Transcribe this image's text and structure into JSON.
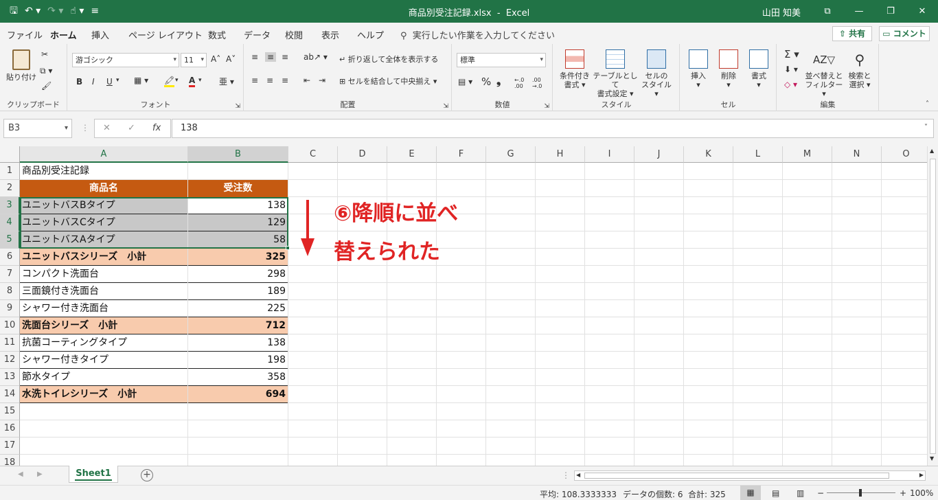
{
  "titlebar": {
    "filename": "商品別受注記録.xlsx",
    "separator": "-",
    "app": "Excel",
    "user": "山田 知美",
    "qat_save": "🖫",
    "qat_undo": "↶ ▾",
    "qat_redo": "↷ ▾",
    "qat_touch": "☝ ▾",
    "qat_custom": "≡",
    "ribbon_display": "⧉",
    "minimize": "—",
    "restore": "❐",
    "close": "✕"
  },
  "menu": {
    "tabs": [
      "ファイル",
      "ホーム",
      "挿入",
      "ページ レイアウト",
      "数式",
      "データ",
      "校閲",
      "表示",
      "ヘルプ"
    ],
    "active_tab": "ホーム",
    "tell_me": "実行したい作業を入力してください",
    "share": "共有",
    "comment": "コメント"
  },
  "ribbon": {
    "clipboard": {
      "label": "クリップボード",
      "paste": "貼り付け"
    },
    "font": {
      "label": "フォント",
      "font_name": "游ゴシック",
      "font_size": "11",
      "bold": "B",
      "italic": "I",
      "underline": "U",
      "grow": "A˄",
      "shrink": "A˅"
    },
    "alignment": {
      "label": "配置",
      "wrap_text": "折り返して全体を表示する",
      "merge_center": "セルを結合して中央揃え"
    },
    "number": {
      "label": "数値",
      "format": "標準",
      "percent": "%",
      "comma": "❟",
      "inc_decimal": "←.0 .00",
      "dec_decimal": ".00 →.0"
    },
    "styles": {
      "label": "スタイル",
      "conditional_1": "条件付き",
      "conditional_2": "書式",
      "table_1": "テーブルとして",
      "table_2": "書式設定",
      "cell_styles_1": "セルの",
      "cell_styles_2": "スタイル"
    },
    "cells": {
      "label": "セル",
      "insert": "挿入",
      "delete": "削除",
      "format": "書式"
    },
    "editing": {
      "label": "編集",
      "autosum": "Σ",
      "sort_filter_1": "並べ替えと",
      "sort_filter_2": "フィルター",
      "find_1": "検索と",
      "find_2": "選択"
    }
  },
  "formula_bar": {
    "name_box": "B3",
    "cancel": "✕",
    "enter": "✓",
    "fx": "fx",
    "content": "138"
  },
  "columns": [
    "A",
    "B",
    "C",
    "D",
    "E",
    "F",
    "G",
    "H",
    "I",
    "J",
    "K",
    "L",
    "M",
    "N",
    "O"
  ],
  "rows": [
    "1",
    "2",
    "3",
    "4",
    "5",
    "6",
    "7",
    "8",
    "9",
    "10",
    "11",
    "12",
    "13",
    "14",
    "15",
    "16",
    "17",
    "18"
  ],
  "sheet": {
    "title": "商品別受注記録",
    "header": {
      "name": "商品名",
      "count": "受注数"
    },
    "data": [
      {
        "name": "ユニットバスBタイプ",
        "count": "138"
      },
      {
        "name": "ユニットバスCタイプ",
        "count": "129"
      },
      {
        "name": "ユニットバスAタイプ",
        "count": "58"
      },
      {
        "name": "ユニットバスシリーズ　小計",
        "count": "325"
      },
      {
        "name": "コンパクト洗面台",
        "count": "298"
      },
      {
        "name": "三面鏡付き洗面台",
        "count": "189"
      },
      {
        "name": "シャワー付き洗面台",
        "count": "225"
      },
      {
        "name": "洗面台シリーズ　小計",
        "count": "712"
      },
      {
        "name": "抗菌コーティングタイプ",
        "count": "138"
      },
      {
        "name": "シャワー付きタイプ",
        "count": "198"
      },
      {
        "name": "節水タイプ",
        "count": "358"
      },
      {
        "name": "水洗トイレシリーズ　小計",
        "count": "694"
      }
    ]
  },
  "annotation": {
    "line1": "⑥降順に並べ",
    "line2": "替えられた",
    "color": "#e02424"
  },
  "sheet_tabs": {
    "active": "Sheet1",
    "add": "+"
  },
  "status": {
    "average": "平均: 108.3333333",
    "count": "データの個数: 6",
    "sum": "合計: 325",
    "zoom": "100%"
  },
  "colors": {
    "excel_green": "#217346",
    "header_fill": "#c55a11",
    "subtotal_fill": "#f8cbad",
    "selected_fill": "#c8c8c8"
  }
}
